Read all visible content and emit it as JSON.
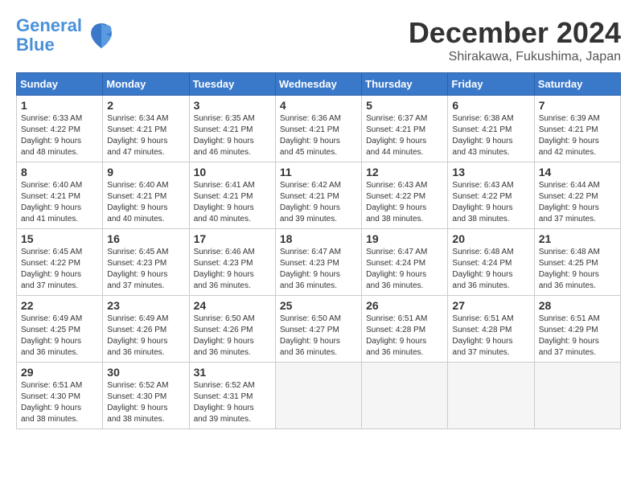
{
  "logo": {
    "line1": "General",
    "line2": "Blue"
  },
  "title": "December 2024",
  "location": "Shirakawa, Fukushima, Japan",
  "weekdays": [
    "Sunday",
    "Monday",
    "Tuesday",
    "Wednesday",
    "Thursday",
    "Friday",
    "Saturday"
  ],
  "weeks": [
    [
      {
        "day": "1",
        "info": "Sunrise: 6:33 AM\nSunset: 4:22 PM\nDaylight: 9 hours\nand 48 minutes."
      },
      {
        "day": "2",
        "info": "Sunrise: 6:34 AM\nSunset: 4:21 PM\nDaylight: 9 hours\nand 47 minutes."
      },
      {
        "day": "3",
        "info": "Sunrise: 6:35 AM\nSunset: 4:21 PM\nDaylight: 9 hours\nand 46 minutes."
      },
      {
        "day": "4",
        "info": "Sunrise: 6:36 AM\nSunset: 4:21 PM\nDaylight: 9 hours\nand 45 minutes."
      },
      {
        "day": "5",
        "info": "Sunrise: 6:37 AM\nSunset: 4:21 PM\nDaylight: 9 hours\nand 44 minutes."
      },
      {
        "day": "6",
        "info": "Sunrise: 6:38 AM\nSunset: 4:21 PM\nDaylight: 9 hours\nand 43 minutes."
      },
      {
        "day": "7",
        "info": "Sunrise: 6:39 AM\nSunset: 4:21 PM\nDaylight: 9 hours\nand 42 minutes."
      }
    ],
    [
      {
        "day": "8",
        "info": "Sunrise: 6:40 AM\nSunset: 4:21 PM\nDaylight: 9 hours\nand 41 minutes."
      },
      {
        "day": "9",
        "info": "Sunrise: 6:40 AM\nSunset: 4:21 PM\nDaylight: 9 hours\nand 40 minutes."
      },
      {
        "day": "10",
        "info": "Sunrise: 6:41 AM\nSunset: 4:21 PM\nDaylight: 9 hours\nand 40 minutes."
      },
      {
        "day": "11",
        "info": "Sunrise: 6:42 AM\nSunset: 4:21 PM\nDaylight: 9 hours\nand 39 minutes."
      },
      {
        "day": "12",
        "info": "Sunrise: 6:43 AM\nSunset: 4:22 PM\nDaylight: 9 hours\nand 38 minutes."
      },
      {
        "day": "13",
        "info": "Sunrise: 6:43 AM\nSunset: 4:22 PM\nDaylight: 9 hours\nand 38 minutes."
      },
      {
        "day": "14",
        "info": "Sunrise: 6:44 AM\nSunset: 4:22 PM\nDaylight: 9 hours\nand 37 minutes."
      }
    ],
    [
      {
        "day": "15",
        "info": "Sunrise: 6:45 AM\nSunset: 4:22 PM\nDaylight: 9 hours\nand 37 minutes."
      },
      {
        "day": "16",
        "info": "Sunrise: 6:45 AM\nSunset: 4:23 PM\nDaylight: 9 hours\nand 37 minutes."
      },
      {
        "day": "17",
        "info": "Sunrise: 6:46 AM\nSunset: 4:23 PM\nDaylight: 9 hours\nand 36 minutes."
      },
      {
        "day": "18",
        "info": "Sunrise: 6:47 AM\nSunset: 4:23 PM\nDaylight: 9 hours\nand 36 minutes."
      },
      {
        "day": "19",
        "info": "Sunrise: 6:47 AM\nSunset: 4:24 PM\nDaylight: 9 hours\nand 36 minutes."
      },
      {
        "day": "20",
        "info": "Sunrise: 6:48 AM\nSunset: 4:24 PM\nDaylight: 9 hours\nand 36 minutes."
      },
      {
        "day": "21",
        "info": "Sunrise: 6:48 AM\nSunset: 4:25 PM\nDaylight: 9 hours\nand 36 minutes."
      }
    ],
    [
      {
        "day": "22",
        "info": "Sunrise: 6:49 AM\nSunset: 4:25 PM\nDaylight: 9 hours\nand 36 minutes."
      },
      {
        "day": "23",
        "info": "Sunrise: 6:49 AM\nSunset: 4:26 PM\nDaylight: 9 hours\nand 36 minutes."
      },
      {
        "day": "24",
        "info": "Sunrise: 6:50 AM\nSunset: 4:26 PM\nDaylight: 9 hours\nand 36 minutes."
      },
      {
        "day": "25",
        "info": "Sunrise: 6:50 AM\nSunset: 4:27 PM\nDaylight: 9 hours\nand 36 minutes."
      },
      {
        "day": "26",
        "info": "Sunrise: 6:51 AM\nSunset: 4:28 PM\nDaylight: 9 hours\nand 36 minutes."
      },
      {
        "day": "27",
        "info": "Sunrise: 6:51 AM\nSunset: 4:28 PM\nDaylight: 9 hours\nand 37 minutes."
      },
      {
        "day": "28",
        "info": "Sunrise: 6:51 AM\nSunset: 4:29 PM\nDaylight: 9 hours\nand 37 minutes."
      }
    ],
    [
      {
        "day": "29",
        "info": "Sunrise: 6:51 AM\nSunset: 4:30 PM\nDaylight: 9 hours\nand 38 minutes."
      },
      {
        "day": "30",
        "info": "Sunrise: 6:52 AM\nSunset: 4:30 PM\nDaylight: 9 hours\nand 38 minutes."
      },
      {
        "day": "31",
        "info": "Sunrise: 6:52 AM\nSunset: 4:31 PM\nDaylight: 9 hours\nand 39 minutes."
      },
      {
        "day": "",
        "info": ""
      },
      {
        "day": "",
        "info": ""
      },
      {
        "day": "",
        "info": ""
      },
      {
        "day": "",
        "info": ""
      }
    ]
  ]
}
